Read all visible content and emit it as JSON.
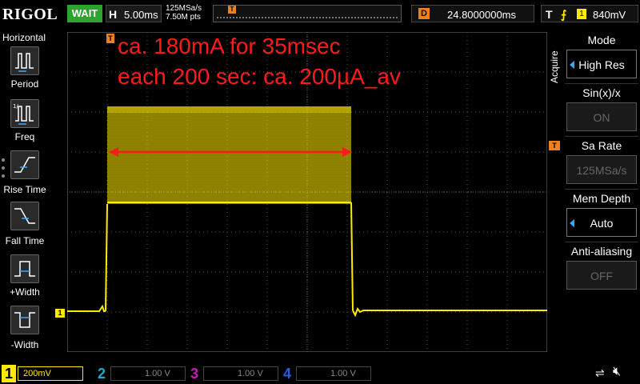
{
  "brand": "RIGOL",
  "top": {
    "run_status": "WAIT",
    "horizontal": {
      "label": "H",
      "value": "5.00ms"
    },
    "sample_rate": "125MSa/s",
    "memory_points": "7.50M pts",
    "trigger_position_marker": "T",
    "delay": {
      "label": "D",
      "value": "24.8000000ms"
    },
    "trigger": {
      "label": "T",
      "edge_symbol": "⨍",
      "source": "1",
      "level": "840mV"
    }
  },
  "left_panel": {
    "title": "Horizontal",
    "items": [
      {
        "label": "Period",
        "icon": "period-icon"
      },
      {
        "label": "Freq",
        "icon": "frequency-icon"
      },
      {
        "label": "Rise Time",
        "icon": "rise-time-icon"
      },
      {
        "label": "Fall Time",
        "icon": "fall-time-icon"
      },
      {
        "label": "+Width",
        "icon": "positive-width-icon"
      },
      {
        "label": "-Width",
        "icon": "negative-width-icon"
      }
    ]
  },
  "screen": {
    "annotation_line1": "ca. 180mA for 35msec",
    "annotation_line2": "each 200 sec: ca. 200µA_av",
    "trigger_marker": "T",
    "trigger_level_marker": "T",
    "ch1_marker": "1",
    "trace_color": "#ffea00",
    "annotation_color": "#ff1a1a"
  },
  "right_panel": {
    "menu_title": "Acquire",
    "items": [
      {
        "label": "Mode",
        "value": "High Res",
        "state": "active",
        "has_arrow": true
      },
      {
        "label": "Sin(x)/x",
        "value": "ON",
        "state": "dim",
        "has_arrow": false
      },
      {
        "label": "Sa Rate",
        "value": "125MSa/s",
        "state": "dim",
        "has_arrow": false
      },
      {
        "label": "Mem Depth",
        "value": "Auto",
        "state": "active",
        "has_arrow": true
      },
      {
        "label": "Anti-aliasing",
        "value": "OFF",
        "state": "dim",
        "has_arrow": false
      }
    ]
  },
  "bottom": {
    "channels": [
      {
        "num": "1",
        "scale": "200mV",
        "color": "#ffea00",
        "active": true
      },
      {
        "num": "2",
        "scale": "1.00 V",
        "color": "#1aa9c8",
        "active": false
      },
      {
        "num": "3",
        "scale": "1.00 V",
        "color": "#c81ab8",
        "active": false
      },
      {
        "num": "4",
        "scale": "1.00 V",
        "color": "#2a5ed8",
        "active": false
      }
    ]
  }
}
